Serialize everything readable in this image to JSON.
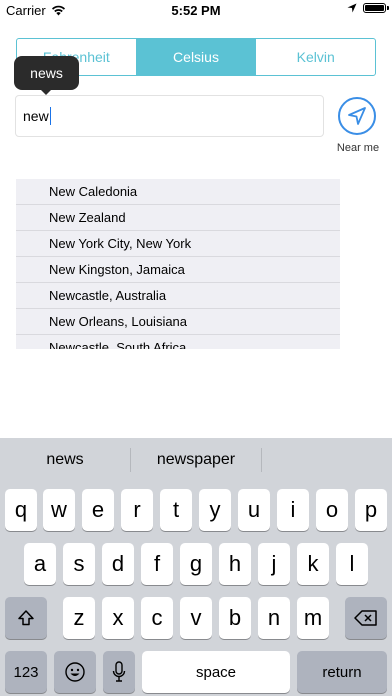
{
  "status_bar": {
    "carrier": "Carrier",
    "time": "5:52 PM"
  },
  "units": {
    "options": [
      "Fahrenheit",
      "Celsius",
      "Kelvin"
    ],
    "selected": "Celsius"
  },
  "tooltip": {
    "text": "news"
  },
  "search": {
    "value": "new"
  },
  "near_me": {
    "label": "Near me"
  },
  "suggestions": [
    "New Caledonia",
    "New Zealand",
    "New York City, New York",
    "New Kingston, Jamaica",
    "Newcastle, Australia",
    "New Orleans, Louisiana",
    "Newcastle, South Africa"
  ],
  "keyboard": {
    "predictions": [
      "news",
      "newspaper",
      ""
    ],
    "row1": [
      "q",
      "w",
      "e",
      "r",
      "t",
      "y",
      "u",
      "i",
      "o",
      "p"
    ],
    "row2": [
      "a",
      "s",
      "d",
      "f",
      "g",
      "h",
      "j",
      "k",
      "l"
    ],
    "row3": [
      "z",
      "x",
      "c",
      "v",
      "b",
      "n",
      "m"
    ],
    "numbers_label": "123",
    "space_label": "space",
    "return_label": "return"
  },
  "colors": {
    "accent": "#5bc2d4",
    "location_blue": "#3a8ee6"
  }
}
